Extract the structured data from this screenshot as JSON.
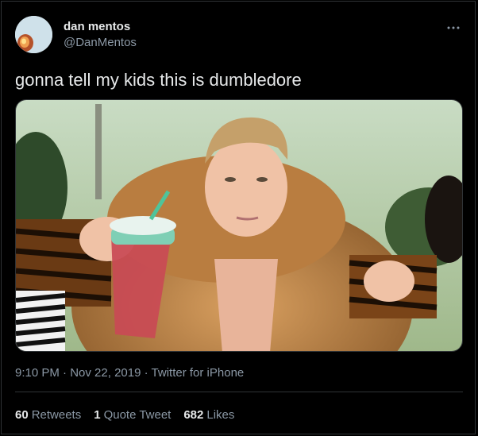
{
  "tweet": {
    "author_name": "dan mentos",
    "author_handle": "@DanMentos",
    "more_icon": "more-horizontal-icon",
    "text": "gonna tell my kids this is dumbledore",
    "time": "9:10 PM",
    "date": "Nov 22, 2019",
    "source": "Twitter for iPhone",
    "separator": "·"
  },
  "stats": {
    "retweets_count": "60",
    "retweets_label": "Retweets",
    "quotes_count": "1",
    "quotes_label": "Quote Tweet",
    "likes_count": "682",
    "likes_label": "Likes"
  },
  "colors": {
    "background": "#000000",
    "primary_text": "#e7e9ea",
    "secondary_text": "#8b98a5",
    "divider": "#2f3336"
  }
}
